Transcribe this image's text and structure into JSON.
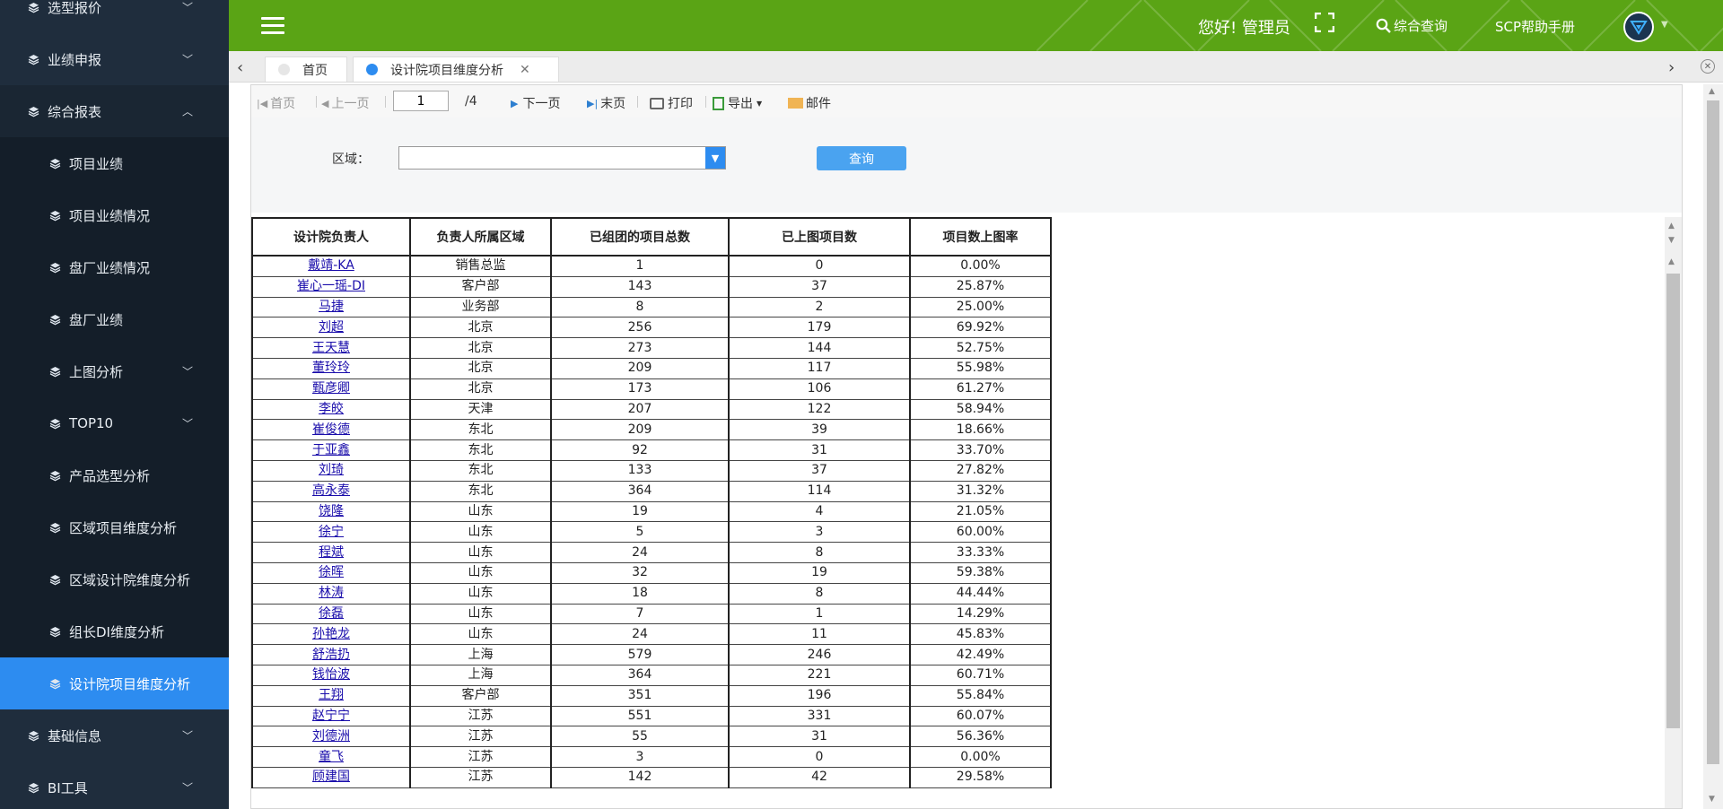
{
  "sidebar": {
    "items": [
      {
        "label": "选型报价",
        "level": "top",
        "chevron": "down"
      },
      {
        "label": "业绩申报",
        "level": "top",
        "chevron": "down"
      },
      {
        "label": "综合报表",
        "level": "top",
        "chevron": "up"
      },
      {
        "label": "项目业绩",
        "level": "sub"
      },
      {
        "label": "项目业绩情况",
        "level": "sub"
      },
      {
        "label": "盘厂业绩情况",
        "level": "sub"
      },
      {
        "label": "盘厂业绩",
        "level": "sub"
      },
      {
        "label": "上图分析",
        "level": "sub",
        "chevron": "down"
      },
      {
        "label": "TOP10",
        "level": "sub",
        "chevron": "down"
      },
      {
        "label": "产品选型分析",
        "level": "sub"
      },
      {
        "label": "区域项目维度分析",
        "level": "sub"
      },
      {
        "label": "区域设计院维度分析",
        "level": "sub"
      },
      {
        "label": "组长DI维度分析",
        "level": "sub"
      },
      {
        "label": "设计院项目维度分析",
        "level": "sub",
        "active": true
      },
      {
        "label": "基础信息",
        "level": "top",
        "chevron": "down"
      },
      {
        "label": "BI工具",
        "level": "top",
        "chevron": "down"
      }
    ]
  },
  "header": {
    "greeting": "您好! 管理员",
    "search_label": "综合查询",
    "help_label": "SCP帮助手册",
    "bg_color": "#5aa415"
  },
  "tabs": [
    {
      "label": "首页",
      "dot_color": "#e6e6e6"
    },
    {
      "label": "设计院项目维度分析",
      "dot_color": "#2d8cf0",
      "closable": true
    }
  ],
  "toolbar": {
    "first": "首页",
    "prev": "上一页",
    "page_value": "1",
    "total_pages": "/4",
    "next": "下一页",
    "last": "末页",
    "print": "打印",
    "export": "导出",
    "mail": "邮件"
  },
  "filter": {
    "region_label": "区域：",
    "region_value": "",
    "query_button": "查询"
  },
  "table": {
    "headers": [
      "设计院负责人",
      "负责人所属区域",
      "已组团的项目总数",
      "已上图项目数",
      "项目数上图率"
    ],
    "rows": [
      [
        "戴靖-KA",
        "销售总监",
        "1",
        "0",
        "0.00%"
      ],
      [
        "崔心一瑶-DI",
        "客户部",
        "143",
        "37",
        "25.87%"
      ],
      [
        "马捷",
        "业务部",
        "8",
        "2",
        "25.00%"
      ],
      [
        "刘超",
        "北京",
        "256",
        "179",
        "69.92%"
      ],
      [
        "王天慧",
        "北京",
        "273",
        "144",
        "52.75%"
      ],
      [
        "董玲玲",
        "北京",
        "209",
        "117",
        "55.98%"
      ],
      [
        "甄彦卿",
        "北京",
        "173",
        "106",
        "61.27%"
      ],
      [
        "李皎",
        "天津",
        "207",
        "122",
        "58.94%"
      ],
      [
        "崔俊德",
        "东北",
        "209",
        "39",
        "18.66%"
      ],
      [
        "于亚鑫",
        "东北",
        "92",
        "31",
        "33.70%"
      ],
      [
        "刘琦",
        "东北",
        "133",
        "37",
        "27.82%"
      ],
      [
        "高永泰",
        "东北",
        "364",
        "114",
        "31.32%"
      ],
      [
        "饶隆",
        "山东",
        "19",
        "4",
        "21.05%"
      ],
      [
        "徐宁",
        "山东",
        "5",
        "3",
        "60.00%"
      ],
      [
        "程斌",
        "山东",
        "24",
        "8",
        "33.33%"
      ],
      [
        "徐晖",
        "山东",
        "32",
        "19",
        "59.38%"
      ],
      [
        "林涛",
        "山东",
        "18",
        "8",
        "44.44%"
      ],
      [
        "徐磊",
        "山东",
        "7",
        "1",
        "14.29%"
      ],
      [
        "孙艳龙",
        "山东",
        "24",
        "11",
        "45.83%"
      ],
      [
        "舒浩扔",
        "上海",
        "579",
        "246",
        "42.49%"
      ],
      [
        "钱怡波",
        "上海",
        "364",
        "221",
        "60.71%"
      ],
      [
        "王翔",
        "客户部",
        "351",
        "196",
        "55.84%"
      ],
      [
        "赵宁宁",
        "江苏",
        "551",
        "331",
        "60.07%"
      ],
      [
        "刘德洲",
        "江苏",
        "55",
        "31",
        "56.36%"
      ],
      [
        "童飞",
        "江苏",
        "3",
        "0",
        "0.00%"
      ],
      [
        "顾建国",
        "江苏",
        "142",
        "42",
        "29.58%"
      ]
    ]
  }
}
